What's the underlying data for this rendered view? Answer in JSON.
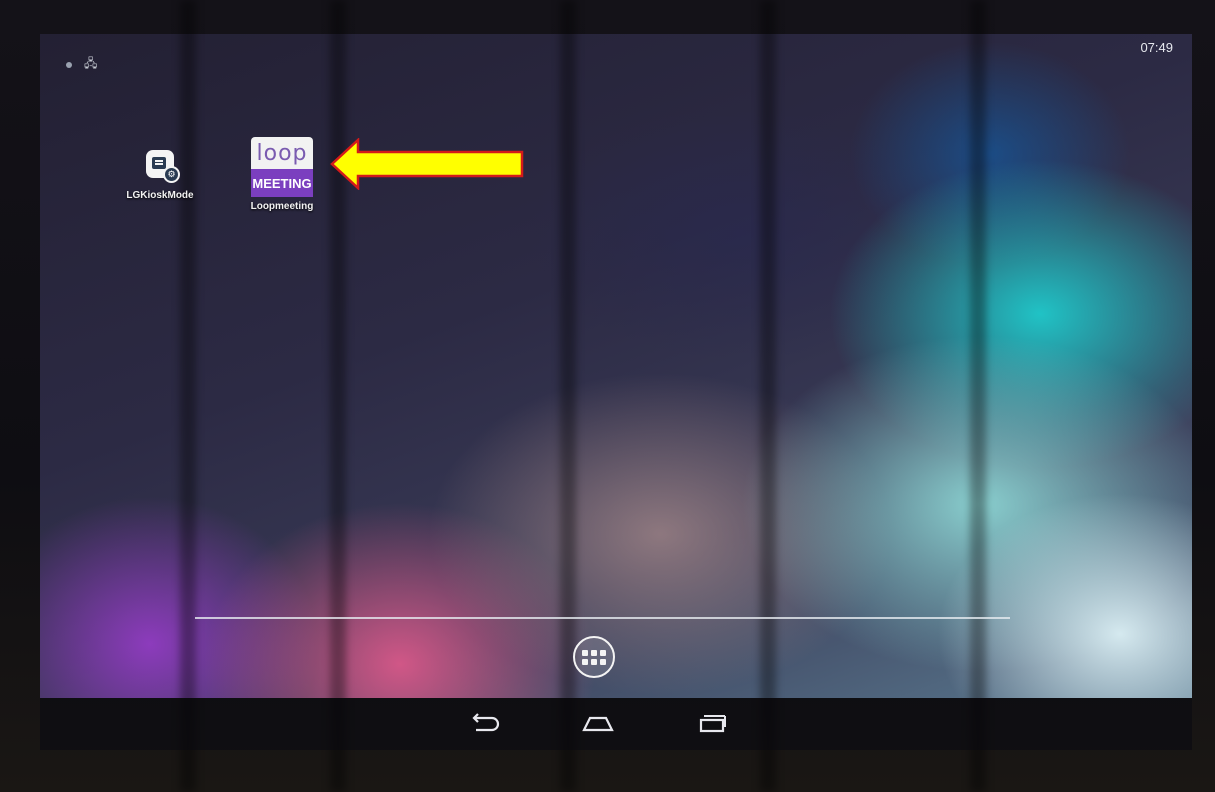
{
  "status_bar": {
    "time": "07:49",
    "icons": [
      "wifi-dot-icon",
      "usb-icon"
    ]
  },
  "apps": [
    {
      "label": "LGKioskMode",
      "icon": "kiosk-settings-icon"
    },
    {
      "label": "Loopmeeting",
      "icon": "loop-meeting-icon",
      "logo_top": "loop",
      "logo_bottom": "MEETING"
    }
  ],
  "annotation": {
    "icon": "yellow-arrow-icon",
    "color": "#ffff00",
    "border": "#d41a1a"
  },
  "dock": {
    "all_apps_icon": "all-apps-icon"
  },
  "navigation": [
    "back-icon",
    "home-icon",
    "recent-apps-icon"
  ],
  "colors": {
    "accent_purple": "#7b3fbf",
    "text": "#f2f2f2"
  }
}
